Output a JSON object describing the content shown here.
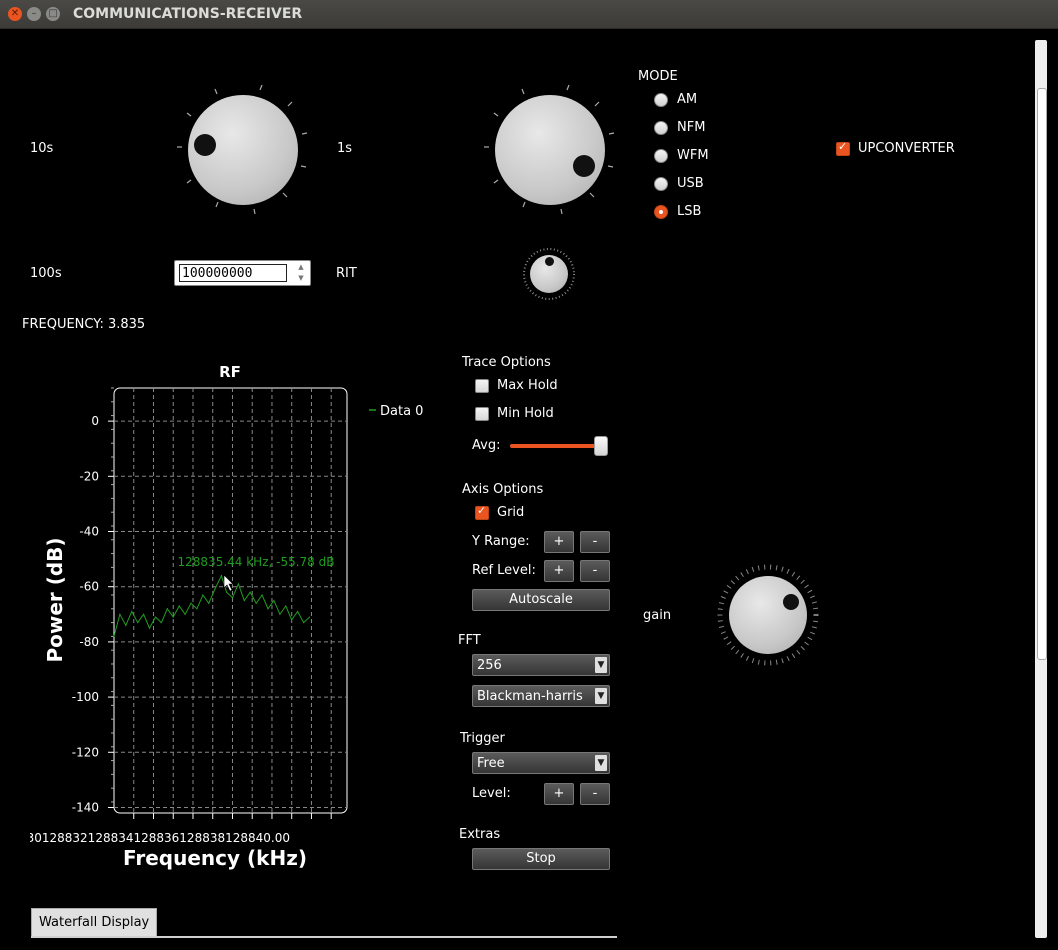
{
  "window": {
    "title": "COMMUNICATIONS-RECEIVER"
  },
  "labels": {
    "tens": "10s",
    "ones": "1s",
    "hundreds": "100s",
    "rit": "RIT",
    "frequency": "FREQUENCY: 3.835",
    "gain": "gain"
  },
  "freq_spinbox": {
    "value": "100000000"
  },
  "mode": {
    "title": "MODE",
    "options": [
      "AM",
      "NFM",
      "WFM",
      "USB",
      "LSB"
    ],
    "selected": "LSB"
  },
  "upconverter": {
    "label": "UPCONVERTER",
    "checked": true
  },
  "trace_options": {
    "title": "Trace Options",
    "max_hold": "Max Hold",
    "min_hold": "Min Hold",
    "avg_label": "Avg:",
    "avg_level": 0.97
  },
  "axis_options": {
    "title": "Axis Options",
    "grid": "Grid",
    "grid_checked": true,
    "y_range": "Y Range:",
    "ref_level": "Ref Level:",
    "plus": "+",
    "minus": "-",
    "autoscale": "Autoscale"
  },
  "fft": {
    "title": "FFT",
    "size": "256",
    "window": "Blackman-harris"
  },
  "trigger": {
    "title": "Trigger",
    "mode": "Free",
    "level": "Level:"
  },
  "extras": {
    "title": "Extras",
    "stop": "Stop"
  },
  "tabs": {
    "waterfall": "Waterfall Display"
  },
  "colors": {
    "accent": "#e95420",
    "trace": "#1f9d1f",
    "background": "#000000"
  },
  "chart_data": {
    "type": "line",
    "title": "RF",
    "xlabel": "Frequency (kHz)",
    "ylabel": "Power (dB)",
    "x_tick_text": "128830128832128834128836128838128840.00",
    "yticks": [
      0,
      -20,
      -40,
      -60,
      -80,
      -100,
      -120,
      -140
    ],
    "ylim": [
      -142,
      12
    ],
    "xlim": [
      128830.0,
      128841.8
    ],
    "grid": true,
    "legend": "top-right",
    "marker_label": "128835.44 kHz, -55.78 dB",
    "series": [
      {
        "name": "Data 0",
        "x": [
          128830.0,
          128830.3,
          128830.6,
          128830.9,
          128831.2,
          128831.5,
          128831.8,
          128832.1,
          128832.4,
          128832.7,
          128833.0,
          128833.3,
          128833.6,
          128833.9,
          128834.2,
          128834.5,
          128834.8,
          128835.1,
          128835.44,
          128835.7,
          128836.0,
          128836.3,
          128836.6,
          128836.9,
          128837.2,
          128837.5,
          128837.8,
          128838.1,
          128838.4,
          128838.7,
          128839.0,
          128839.3,
          128839.6,
          128839.9
        ],
        "values": [
          -78,
          -70,
          -74,
          -69,
          -73,
          -70,
          -75,
          -71,
          -73,
          -68,
          -71,
          -67,
          -70,
          -66,
          -68,
          -63,
          -66,
          -61,
          -56,
          -62,
          -64,
          -59,
          -65,
          -62,
          -66,
          -63,
          -68,
          -65,
          -70,
          -67,
          -72,
          -69,
          -73,
          -71
        ]
      }
    ]
  }
}
